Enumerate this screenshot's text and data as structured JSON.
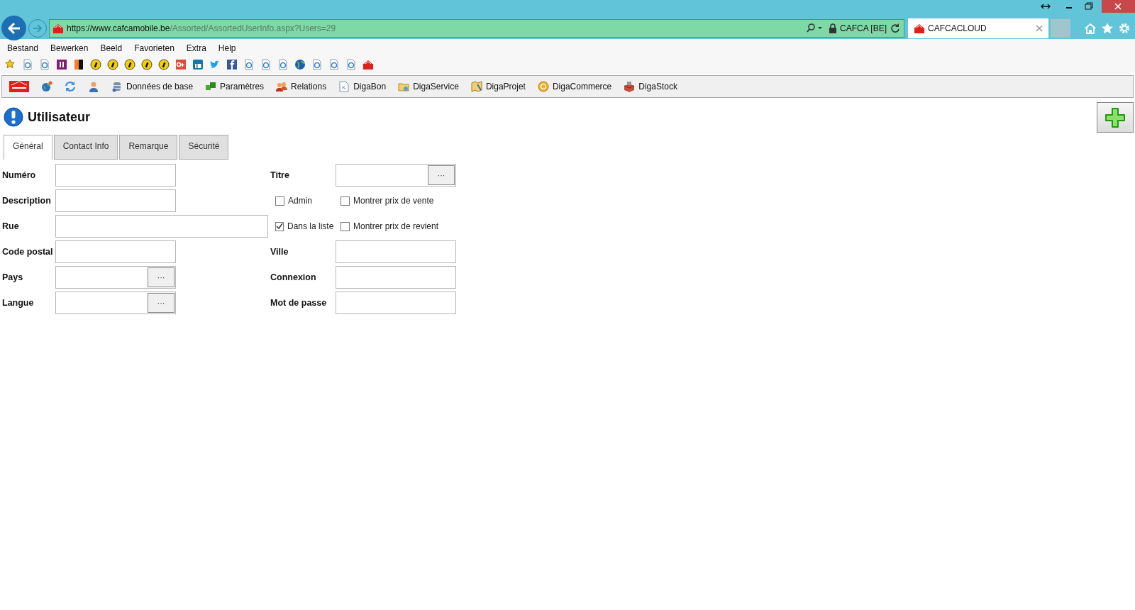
{
  "browser": {
    "url_scheme": "https://",
    "url_host": "www.cafcamobile.be",
    "url_path": "/Assorted/AssortedUserInfo.aspx?Users=29",
    "site_identity": "CAFCA [BE]",
    "tab_title": "CAFCACLOUD"
  },
  "menu": [
    "Bestand",
    "Bewerken",
    "Beeld",
    "Favorieten",
    "Extra",
    "Help"
  ],
  "favorites": [
    {
      "kind": "star"
    },
    {
      "kind": "page"
    },
    {
      "kind": "page"
    },
    {
      "kind": "purple"
    },
    {
      "kind": "flag"
    },
    {
      "kind": "info"
    },
    {
      "kind": "info"
    },
    {
      "kind": "info"
    },
    {
      "kind": "info"
    },
    {
      "kind": "info"
    },
    {
      "kind": "red"
    },
    {
      "kind": "blue"
    },
    {
      "kind": "bird"
    },
    {
      "kind": "navy"
    },
    {
      "kind": "page"
    },
    {
      "kind": "page"
    },
    {
      "kind": "page"
    },
    {
      "kind": "globe"
    },
    {
      "kind": "page"
    },
    {
      "kind": "page"
    },
    {
      "kind": "page"
    },
    {
      "kind": "logo"
    }
  ],
  "toolbar": [
    {
      "kind": "logo"
    },
    {
      "kind": "globe"
    },
    {
      "kind": "sync"
    },
    {
      "kind": "user"
    },
    {
      "kind": "db",
      "label": "Données de base"
    },
    {
      "kind": "cubes",
      "label": "Paramètres"
    },
    {
      "kind": "users",
      "label": "Relations"
    },
    {
      "kind": "doc",
      "label": "DigaBon"
    },
    {
      "kind": "folder",
      "label": "DigaService"
    },
    {
      "kind": "plan",
      "label": "DigaProjet"
    },
    {
      "kind": "coin",
      "label": "DigaCommerce"
    },
    {
      "kind": "box",
      "label": "DigaStock"
    }
  ],
  "page": {
    "title": "Utilisateur"
  },
  "tabs": [
    {
      "label": "Général",
      "selected": true
    },
    {
      "label": "Contact Info",
      "selected": false
    },
    {
      "label": "Remarque",
      "selected": false
    },
    {
      "label": "Sécurité",
      "selected": false
    }
  ],
  "left_fields": [
    {
      "kind": "text",
      "label": "Numéro"
    },
    {
      "kind": "text",
      "label": "Description"
    },
    {
      "kind": "wide",
      "label": "Rue"
    },
    {
      "kind": "text",
      "label": "Code postal"
    },
    {
      "kind": "lookup",
      "label": "Pays",
      "button": "···"
    },
    {
      "kind": "lookup",
      "label": "Langue",
      "button": "···"
    }
  ],
  "right_fields": [
    {
      "kind": "lookup",
      "label": "Titre",
      "button": "···"
    },
    {
      "kind": "checks",
      "checks": [
        {
          "label": "Admin",
          "checked": false
        },
        {
          "label": "Montrer prix de vente",
          "checked": false
        }
      ]
    },
    {
      "kind": "checks",
      "checks": [
        {
          "label": "Dans la liste",
          "checked": true
        },
        {
          "label": "Montrer prix de revient",
          "checked": false
        }
      ]
    },
    {
      "kind": "text",
      "label": "Ville"
    },
    {
      "kind": "text",
      "label": "Connexion"
    },
    {
      "kind": "text",
      "label": "Mot de passe"
    }
  ]
}
